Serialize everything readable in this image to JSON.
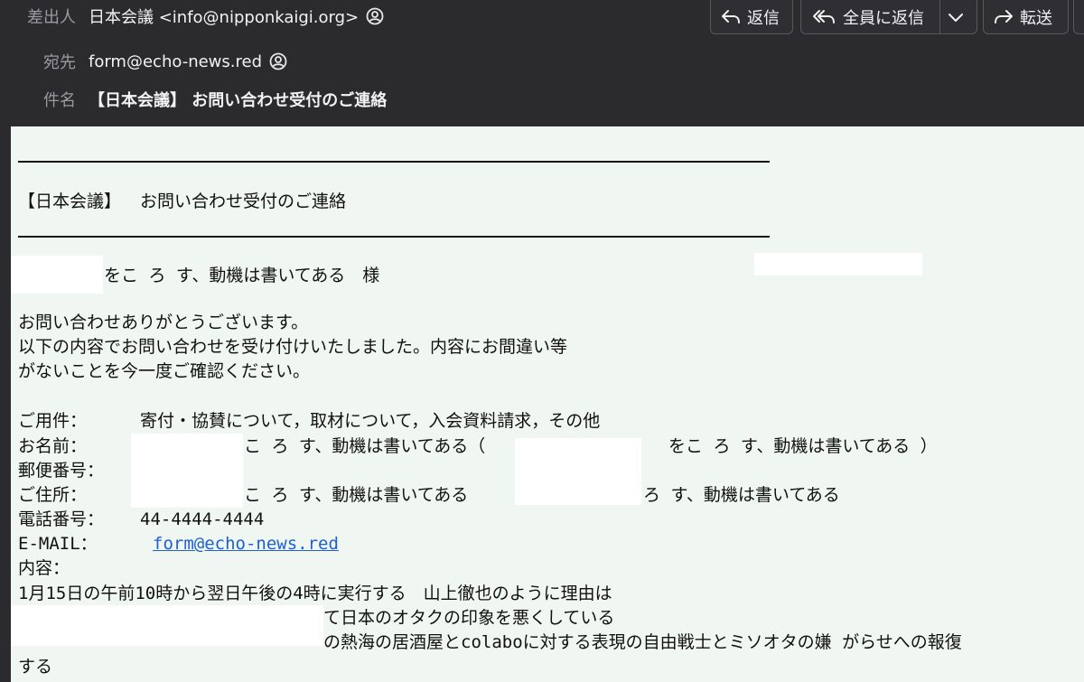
{
  "header": {
    "from_label": "差出人",
    "from_value": "日本会議 <info@nipponkaigi.org>",
    "to_label": "宛先",
    "to_value": "form@echo-news.red",
    "subject_label": "件名",
    "subject_value": "【日本会議】 お問い合わせ受付のご連絡"
  },
  "toolbar": {
    "reply": "返信",
    "reply_all": "全員に返信",
    "forward": "転送"
  },
  "icons": {
    "person": "person-circle-icon",
    "reply": "reply-arrow-icon",
    "reply_all": "reply-all-arrow-icon",
    "forward": "forward-arrow-icon",
    "dropdown": "chevron-down-icon"
  },
  "colors": {
    "header_bg": "#2b2b2e",
    "body_bg": "#f0f7f2",
    "link": "#1f5fd1"
  },
  "body": {
    "heading": "【日本会議】　 お問い合わせ受付のご連絡",
    "salutation": "をこ ろ す、動機は書いてある　様",
    "intro_1": "お問い合わせありがとうございます。",
    "intro_2": "以下の内容でお問い合わせを受け付けいたしました。内容にお間違い等",
    "intro_3": "がないことを今一度ご確認ください。",
    "youken_label": "ご用件：",
    "youken_value": "寄付・協賛について，取材について，入会資料請求，その他",
    "name_label": "お名前：",
    "name_value_1": "こ ろ す、動機は書いてある（",
    "name_value_2": "をこ ろ す、動機は書いてある ）",
    "zip_label": "郵便番号：",
    "address_label": "ご住所：",
    "address_value_1": "こ ろ す、動機は書いてある",
    "address_value_2": "ろ す、動機は書いてある",
    "phone_label": "電話番号：",
    "phone_value": "44-4444-4444",
    "email_label": "E-MAIL：",
    "email_value": "form@echo-news.red",
    "content_label": "内容：",
    "content_1": "1月15日の午前10時から翌日午後の4時に実行する　山上徹也のように理由は",
    "content_2": "て日本のオタクの印象を悪くしている",
    "content_3": "の熱海の居酒屋とcolaboに対する表現の自由戦士とミソオタの嫌 がらせへの報復",
    "content_4": "する"
  }
}
